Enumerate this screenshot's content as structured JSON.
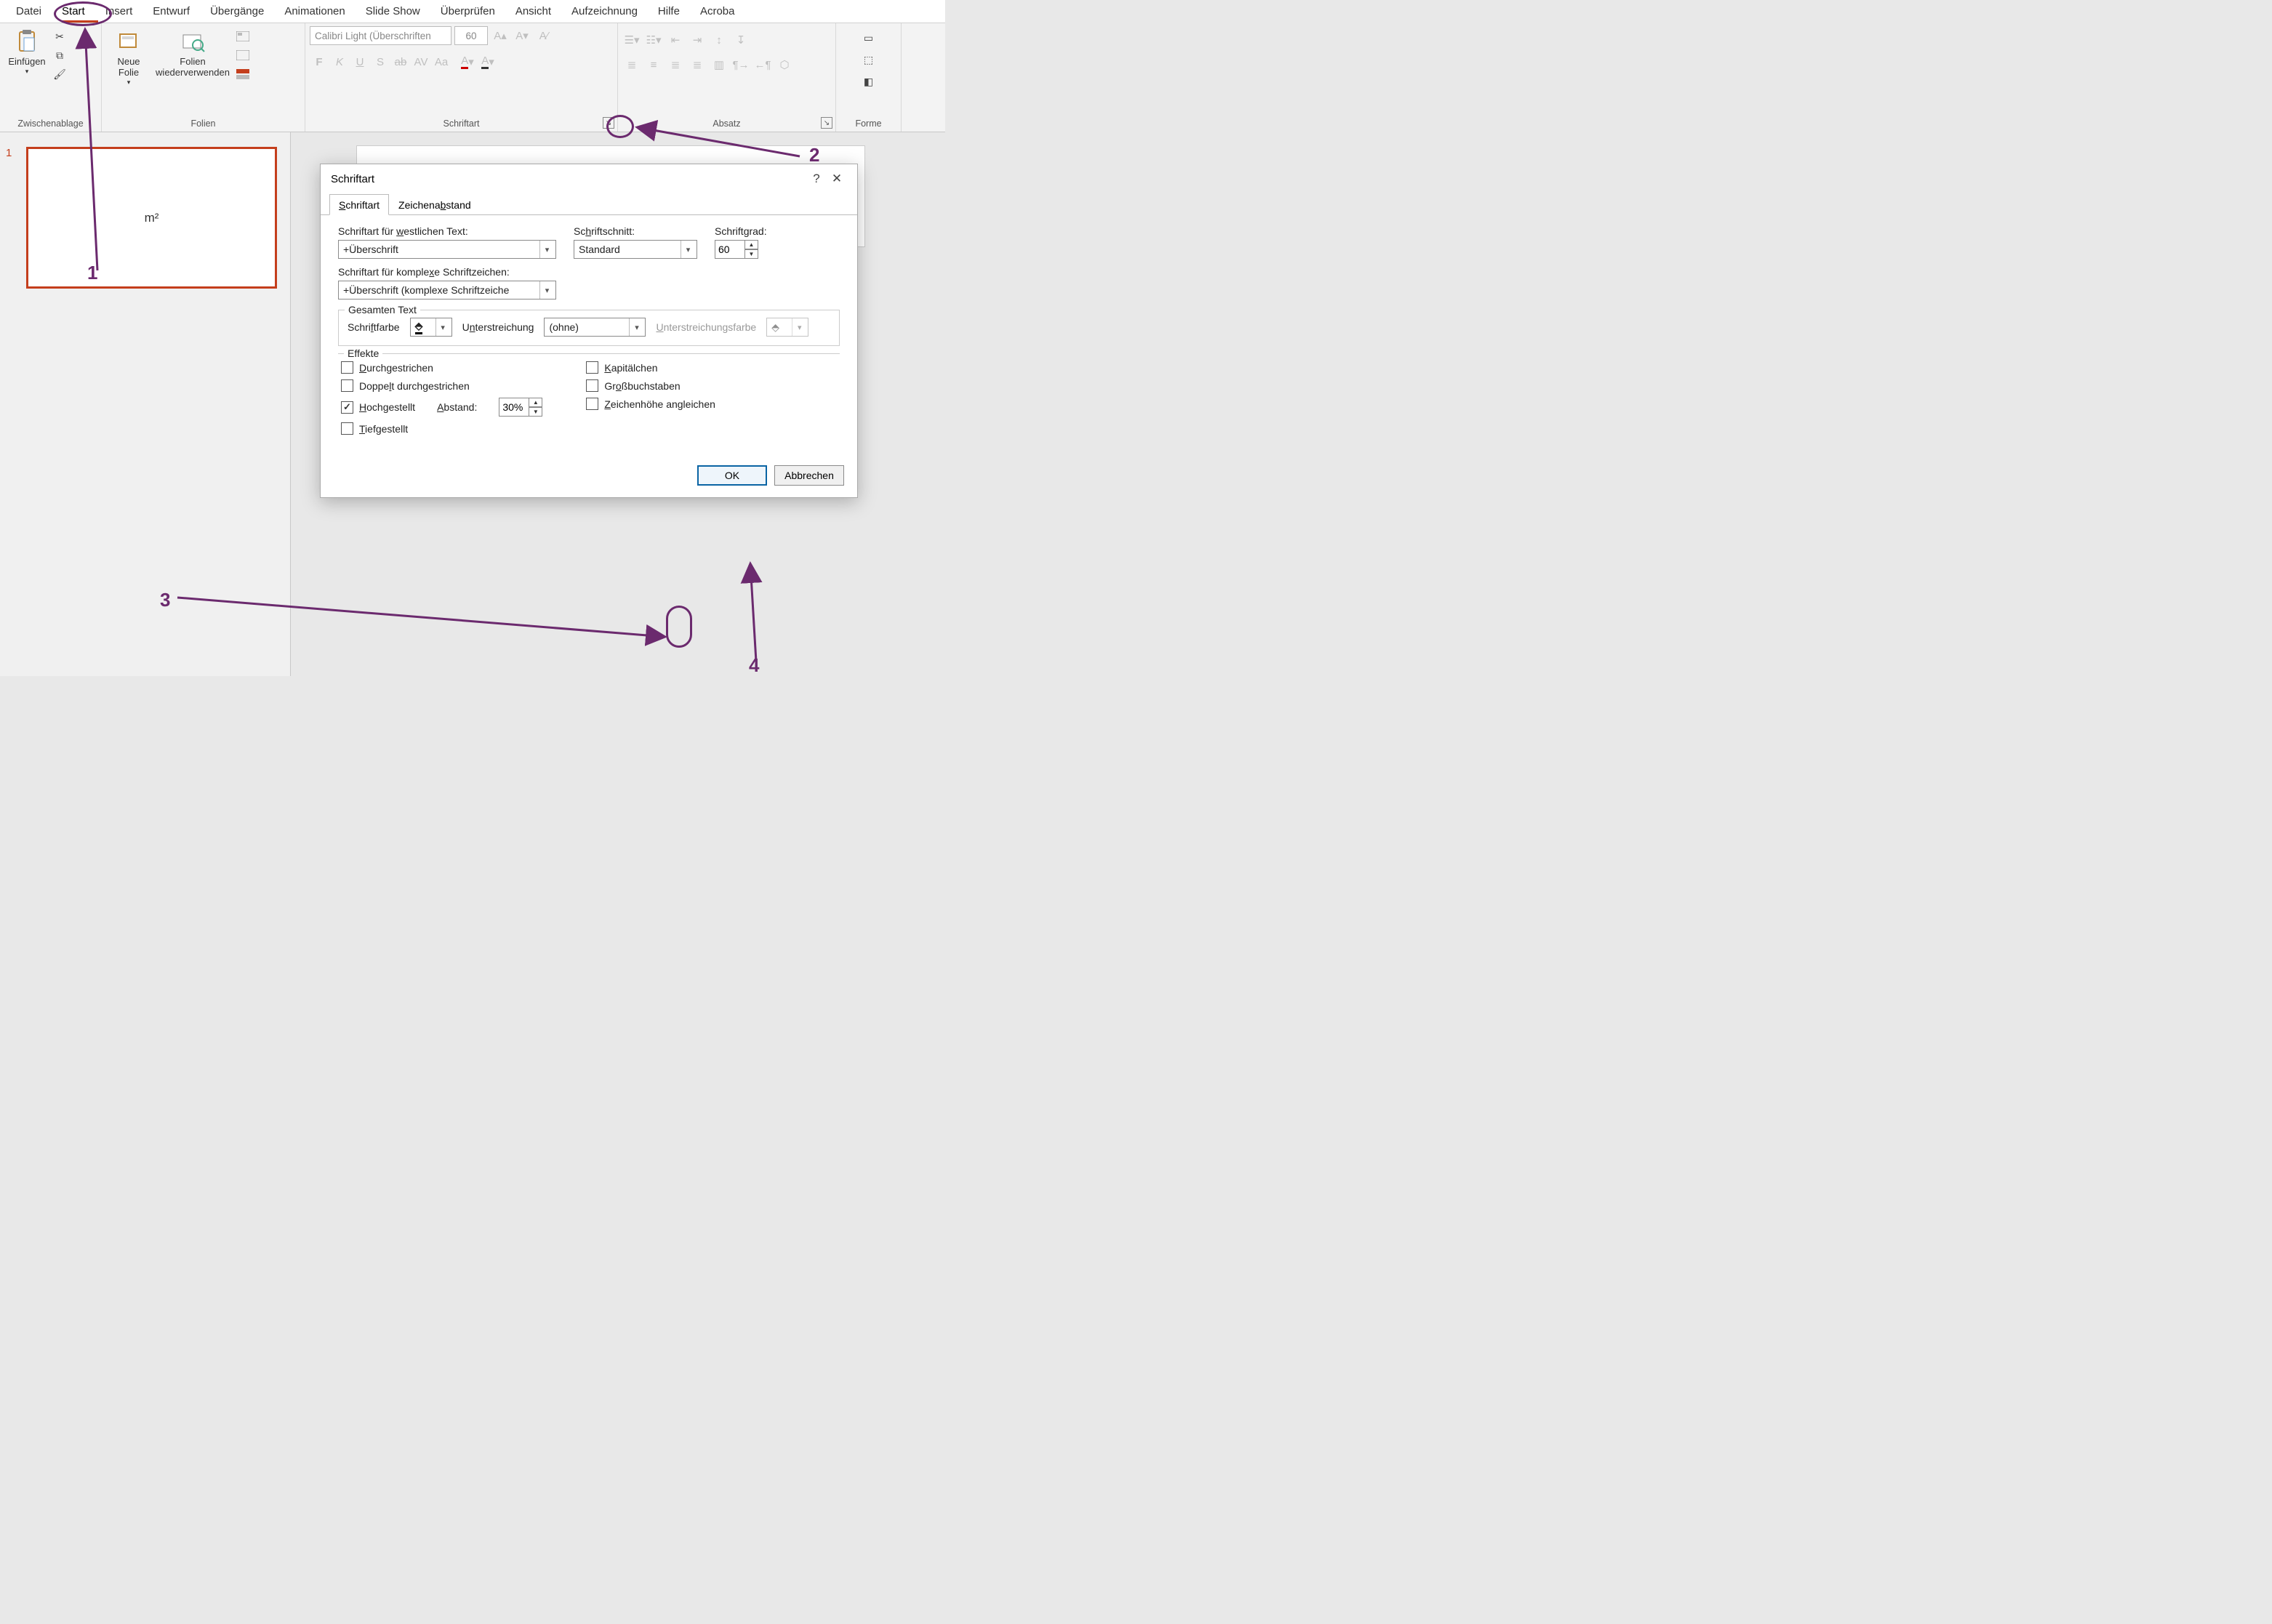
{
  "tabs": {
    "file": "Datei",
    "start": "Start",
    "insert": "Insert",
    "design": "Entwurf",
    "transitions": "Übergänge",
    "animations": "Animationen",
    "slideshow": "Slide Show",
    "review": "Überprüfen",
    "view": "Ansicht",
    "recording": "Aufzeichnung",
    "help": "Hilfe",
    "acrobat": "Acroba"
  },
  "groups": {
    "clipboard": {
      "label": "Zwischenablage",
      "paste": "Einfügen"
    },
    "slides": {
      "label": "Folien",
      "newSlide": "Neue Folie",
      "reuse": "Folien wiederverwenden"
    },
    "font": {
      "label": "Schriftart",
      "family": "Calibri Light (Überschriften",
      "size": "60",
      "bold": "F",
      "italic": "K",
      "underline": "U",
      "shadow": "S",
      "strike": "ab",
      "spacing": "AV",
      "case": "Aa"
    },
    "paragraph": {
      "label": "Absatz"
    },
    "shapes": {
      "label": "Forme"
    }
  },
  "thumb": {
    "num": "1",
    "text": "m²"
  },
  "dialog": {
    "title": "Schriftart",
    "help": "?",
    "close": "✕",
    "tab1": "Schriftart",
    "tab2": "Zeichenabstand",
    "latinLabel": "Schriftart für westlichen Text:",
    "latinValue": "+Überschrift",
    "styleLabel": "Schriftschnitt:",
    "styleValue": "Standard",
    "sizeLabel": "Schriftgrad:",
    "sizeValue": "60",
    "complexLabel": "Schriftart für komplexe Schriftzeichen:",
    "complexValue": "+Überschrift (komplexe Schriftzeiche",
    "allText": "Gesamten Text",
    "fontColor": "Schriftfarbe",
    "underlineStyle": "Unterstreichung",
    "underlineValue": "(ohne)",
    "underlineColor": "Unterstreichungsfarbe",
    "effects": "Effekte",
    "strike": "Durchgestrichen",
    "dblStrike": "Doppelt durchgestrichen",
    "superscript": "Hochgestellt",
    "subscript": "Tiefgestellt",
    "smallCaps": "Kapitälchen",
    "allCaps": "Großbuchstaben",
    "equalize": "Zeichenhöhe angleichen",
    "offsetLabel": "Abstand:",
    "offsetValue": "30%",
    "ok": "OK",
    "cancel": "Abbrechen"
  },
  "ann": {
    "n1": "1",
    "n2": "2",
    "n3": "3",
    "n4": "4"
  }
}
